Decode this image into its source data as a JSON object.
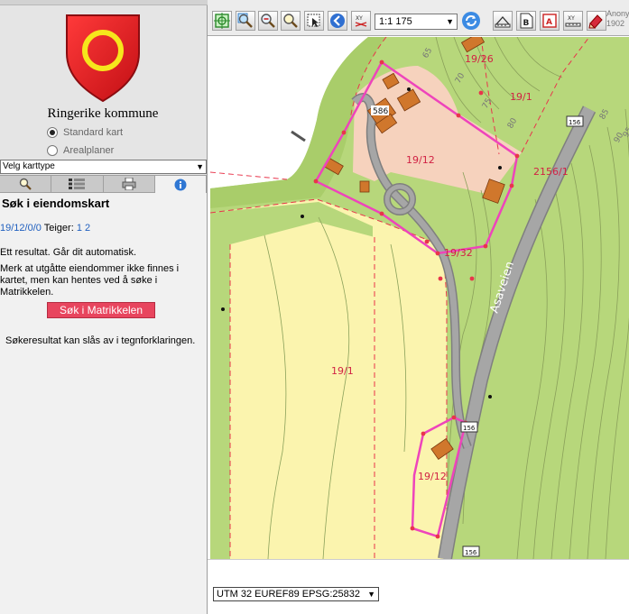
{
  "sidebar": {
    "kommune_name": "Ringerike kommune",
    "radio_options": [
      {
        "label": "Standard kart",
        "selected": true
      },
      {
        "label": "Arealplaner",
        "selected": false
      }
    ],
    "karttype_select": "Velg karttype",
    "tabs": [
      {
        "icon": "search-icon",
        "active": false
      },
      {
        "icon": "legend-icon",
        "active": false
      },
      {
        "icon": "print-icon",
        "active": false
      },
      {
        "icon": "info-icon",
        "active": true
      }
    ],
    "panel": {
      "title": "Søk i eiendomskart",
      "property_id": "19/12/0/0",
      "teiger_label": "Teiger:",
      "teiger_links": [
        "1",
        "2"
      ],
      "result_msg": "Ett resultat. Går dit automatisk.",
      "note": "Merk at utgåtte eiendommer ikke finnes i kartet, men kan hentes ved å søke i Matrikkelen.",
      "matrikkel_button": "Søk i Matrikkelen",
      "toggle_note": "Søkeresultat kan slås av i tegnforklaringen."
    }
  },
  "toolbar": {
    "scale_value": "1:1 175",
    "anon_text_1": "Anonym",
    "anon_text_2": "1902",
    "tools": [
      "zoom-extent-icon",
      "zoom-box-icon",
      "zoom-out-icon",
      "zoom-search-icon",
      "select-icon",
      "back-icon",
      "xy-clear-icon",
      "refresh-icon",
      "measure-icon",
      "document-icon",
      "area-measure-icon",
      "xy-icon",
      "draw-icon"
    ]
  },
  "map": {
    "labels": {
      "p1926": "19/26",
      "p191a": "19/1",
      "p1912a": "19/12",
      "p21561": "2156/1",
      "p1932": "19/32",
      "p191b": "19/1",
      "p1912b": "19/12",
      "house_no": "586",
      "road_name": "Asaveien",
      "road_sign_1": "156",
      "road_sign_2": "156",
      "road_sign_3": "156",
      "contour_65": "65",
      "contour_70": "70",
      "contour_75": "75",
      "contour_80": "80",
      "contour_85": "85",
      "contour_90": "90",
      "contour_95": "95"
    },
    "colors": {
      "grass": "#b7d77b",
      "field": "#fbf4ae",
      "residential": "#f6d2bd",
      "boundary": "#ee44bb",
      "road": "#9a9a9a",
      "building": "#d0772c"
    }
  },
  "footer": {
    "projection": "UTM 32 EUREF89 EPSG:25832"
  }
}
